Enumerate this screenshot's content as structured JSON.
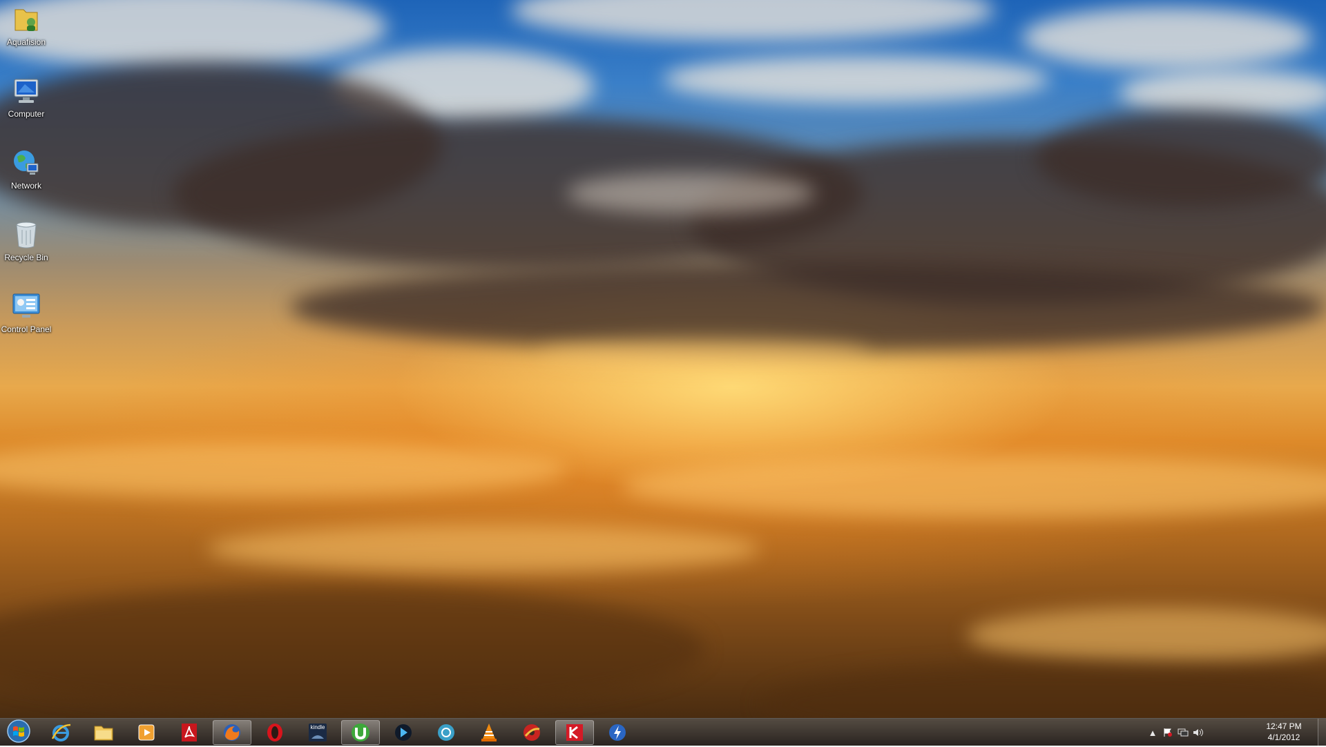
{
  "desktop": {
    "icons": [
      {
        "label": "Aquafision",
        "icon": "user-folder-icon"
      },
      {
        "label": "Computer",
        "icon": "computer-icon"
      },
      {
        "label": "Network",
        "icon": "network-icon"
      },
      {
        "label": "Recycle Bin",
        "icon": "recycle-bin-icon"
      },
      {
        "label": "Control Panel",
        "icon": "control-panel-icon"
      }
    ]
  },
  "taskbar": {
    "start": {
      "icon": "windows-start-icon"
    },
    "pinned": [
      {
        "icon": "internet-explorer-icon",
        "active": false
      },
      {
        "icon": "file-explorer-icon",
        "active": false
      },
      {
        "icon": "media-player-icon",
        "active": false
      },
      {
        "icon": "adobe-reader-icon",
        "active": false
      },
      {
        "icon": "firefox-icon",
        "active": true
      },
      {
        "icon": "opera-icon",
        "active": false
      },
      {
        "icon": "kindle-icon",
        "active": false,
        "text": "kindle"
      },
      {
        "icon": "utorrent-icon",
        "active": true
      },
      {
        "icon": "media-center-icon",
        "active": false
      },
      {
        "icon": "steam-like-icon",
        "active": false
      },
      {
        "icon": "vlc-icon",
        "active": false
      },
      {
        "icon": "cd-burner-icon",
        "active": false
      },
      {
        "icon": "kaspersky-icon",
        "active": true
      },
      {
        "icon": "winamp-icon",
        "active": false
      }
    ],
    "tray": {
      "icons": [
        "show-hidden-icons-chevron",
        "action-center-flag-icon",
        "network-tray-icon",
        "volume-icon"
      ],
      "time": "12:47 PM",
      "date": "4/1/2012"
    }
  },
  "colors": {
    "sky_top": "#1e64b8",
    "sun_glow": "#ffdc78",
    "sea_of_clouds": "#dd8a2a",
    "taskbar": "#2a2118"
  }
}
